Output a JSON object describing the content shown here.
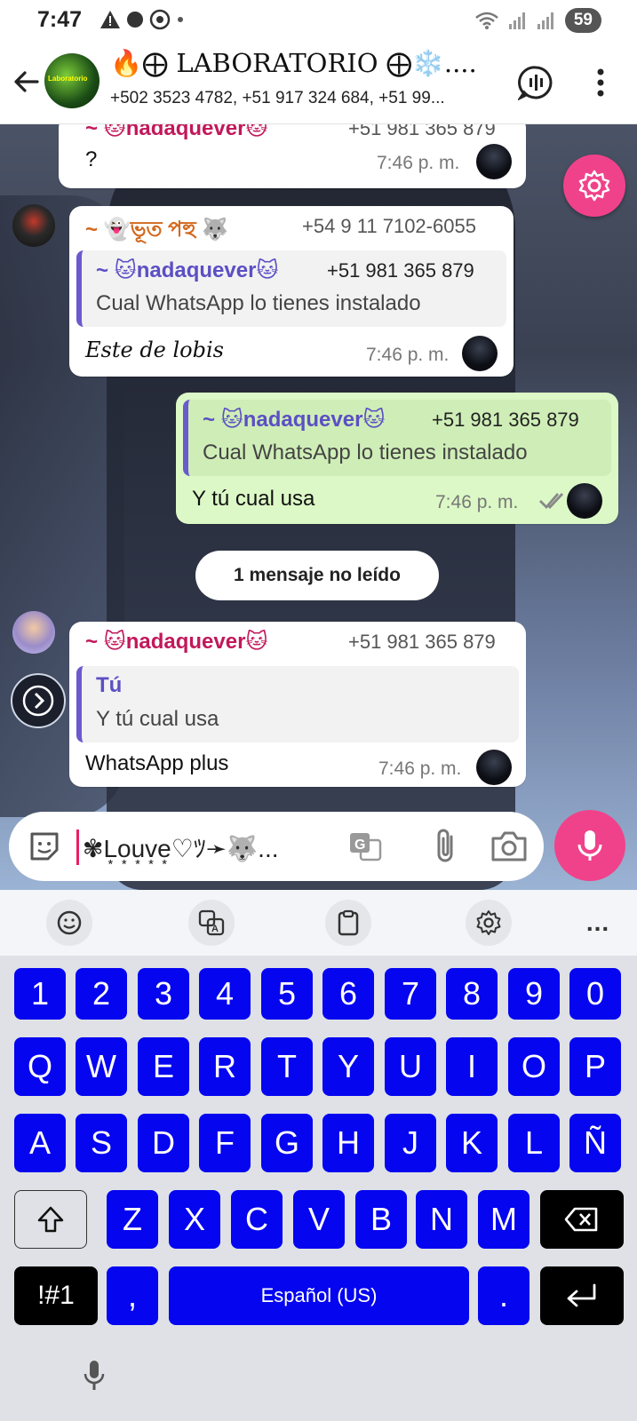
{
  "status_bar": {
    "time": "7:47",
    "battery": "59",
    "signal_badge": "5"
  },
  "header": {
    "title": "🔥⨁ LABORATORIO ⨁❄️....",
    "members": "+502 3523 4782, +51 917 324 684, +51 99...",
    "avatar_text": "Laboratorio"
  },
  "messages": [
    {
      "sender": "~ 🐱nadaquever🐱",
      "phone": "+51 981 365 879",
      "text": "?",
      "time": "7:46 p. m."
    },
    {
      "sender": "~ 👻ভূত পহু 🐺",
      "phone": "+54 9 11 7102-6055",
      "quote_sender": "~ 🐱nadaquever🐱",
      "quote_phone": "+51 981 365 879",
      "quote_text": "Cual WhatsApp lo tienes instalado",
      "text": "Este de lobis",
      "time": "7:46 p. m."
    },
    {
      "quote_sender": "~ 🐱nadaquever🐱",
      "quote_phone": "+51 981 365 879",
      "quote_text": "Cual WhatsApp lo tienes instalado",
      "text": "Y tú cual usa",
      "time": "7:46 p. m."
    },
    {
      "sender": "~ 🐱nadaquever🐱",
      "phone": "+51 981 365 879",
      "quote_sender": "Tú",
      "quote_text": "Y tú cual usa",
      "text": "WhatsApp plus",
      "time": "7:46 p. m."
    }
  ],
  "unread_label": "1 mensaje no leído",
  "composer": {
    "draft": "✾L͙o͙u͙v͙e͙♡ﾂ➛🐺..."
  },
  "keyboard": {
    "row_numbers": [
      "1",
      "2",
      "3",
      "4",
      "5",
      "6",
      "7",
      "8",
      "9",
      "0"
    ],
    "row1": [
      "Q",
      "W",
      "E",
      "R",
      "T",
      "Y",
      "U",
      "I",
      "O",
      "P"
    ],
    "row2": [
      "A",
      "S",
      "D",
      "F",
      "G",
      "H",
      "J",
      "K",
      "L",
      "Ñ"
    ],
    "row3": [
      "Z",
      "X",
      "C",
      "V",
      "B",
      "N",
      "M"
    ],
    "symbols_key": "!#1",
    "comma_key": ",",
    "space_label": "Español (US)",
    "period_key": ".",
    "more_label": "..."
  },
  "colors": {
    "accent_pink": "#f0428a",
    "key_blue": "#0505f0",
    "out_bubble": "#dcf8c6"
  },
  "icons": [
    "back-arrow-icon",
    "voice-chat-icon",
    "more-vert-icon",
    "settings-icon",
    "chevron-right-icon",
    "sticker-icon",
    "translate-icon",
    "attach-icon",
    "camera-icon",
    "mic-icon",
    "double-check-icon",
    "emoji-icon",
    "clipboard-icon",
    "shift-icon",
    "backspace-icon",
    "enter-icon"
  ]
}
